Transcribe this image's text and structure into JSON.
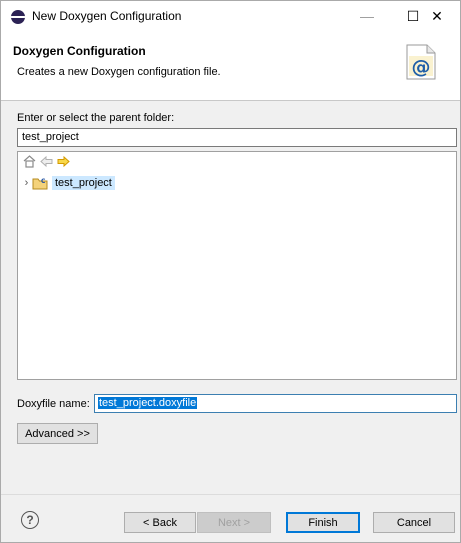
{
  "window": {
    "title": "New Doxygen Configuration",
    "minimize_glyph": "—",
    "maximize_glyph": "☐",
    "close_glyph": "✕"
  },
  "header": {
    "title": "Doxygen Configuration",
    "description": "Creates a new Doxygen configuration file.",
    "icon": "doxygen-at-icon"
  },
  "parent_folder": {
    "label": "Enter or select the parent folder:",
    "value": "test_project"
  },
  "tree": {
    "toolbar_icons": [
      "home-icon",
      "back-arrow-icon",
      "forward-arrow-icon"
    ],
    "items": [
      {
        "label": "test_project",
        "icon": "project-folder-icon",
        "expanded": false,
        "selected": true
      }
    ]
  },
  "doxyfile": {
    "label": "Doxyfile name:",
    "value": "test_project.doxyfile"
  },
  "buttons": {
    "advanced": "Advanced >>",
    "back": "< Back",
    "next": "Next >",
    "finish": "Finish",
    "cancel": "Cancel",
    "help": "?"
  },
  "colors": {
    "selection": "#0078d7",
    "tree_selection": "#cce8ff",
    "forward_arrow": "#e8b400"
  }
}
